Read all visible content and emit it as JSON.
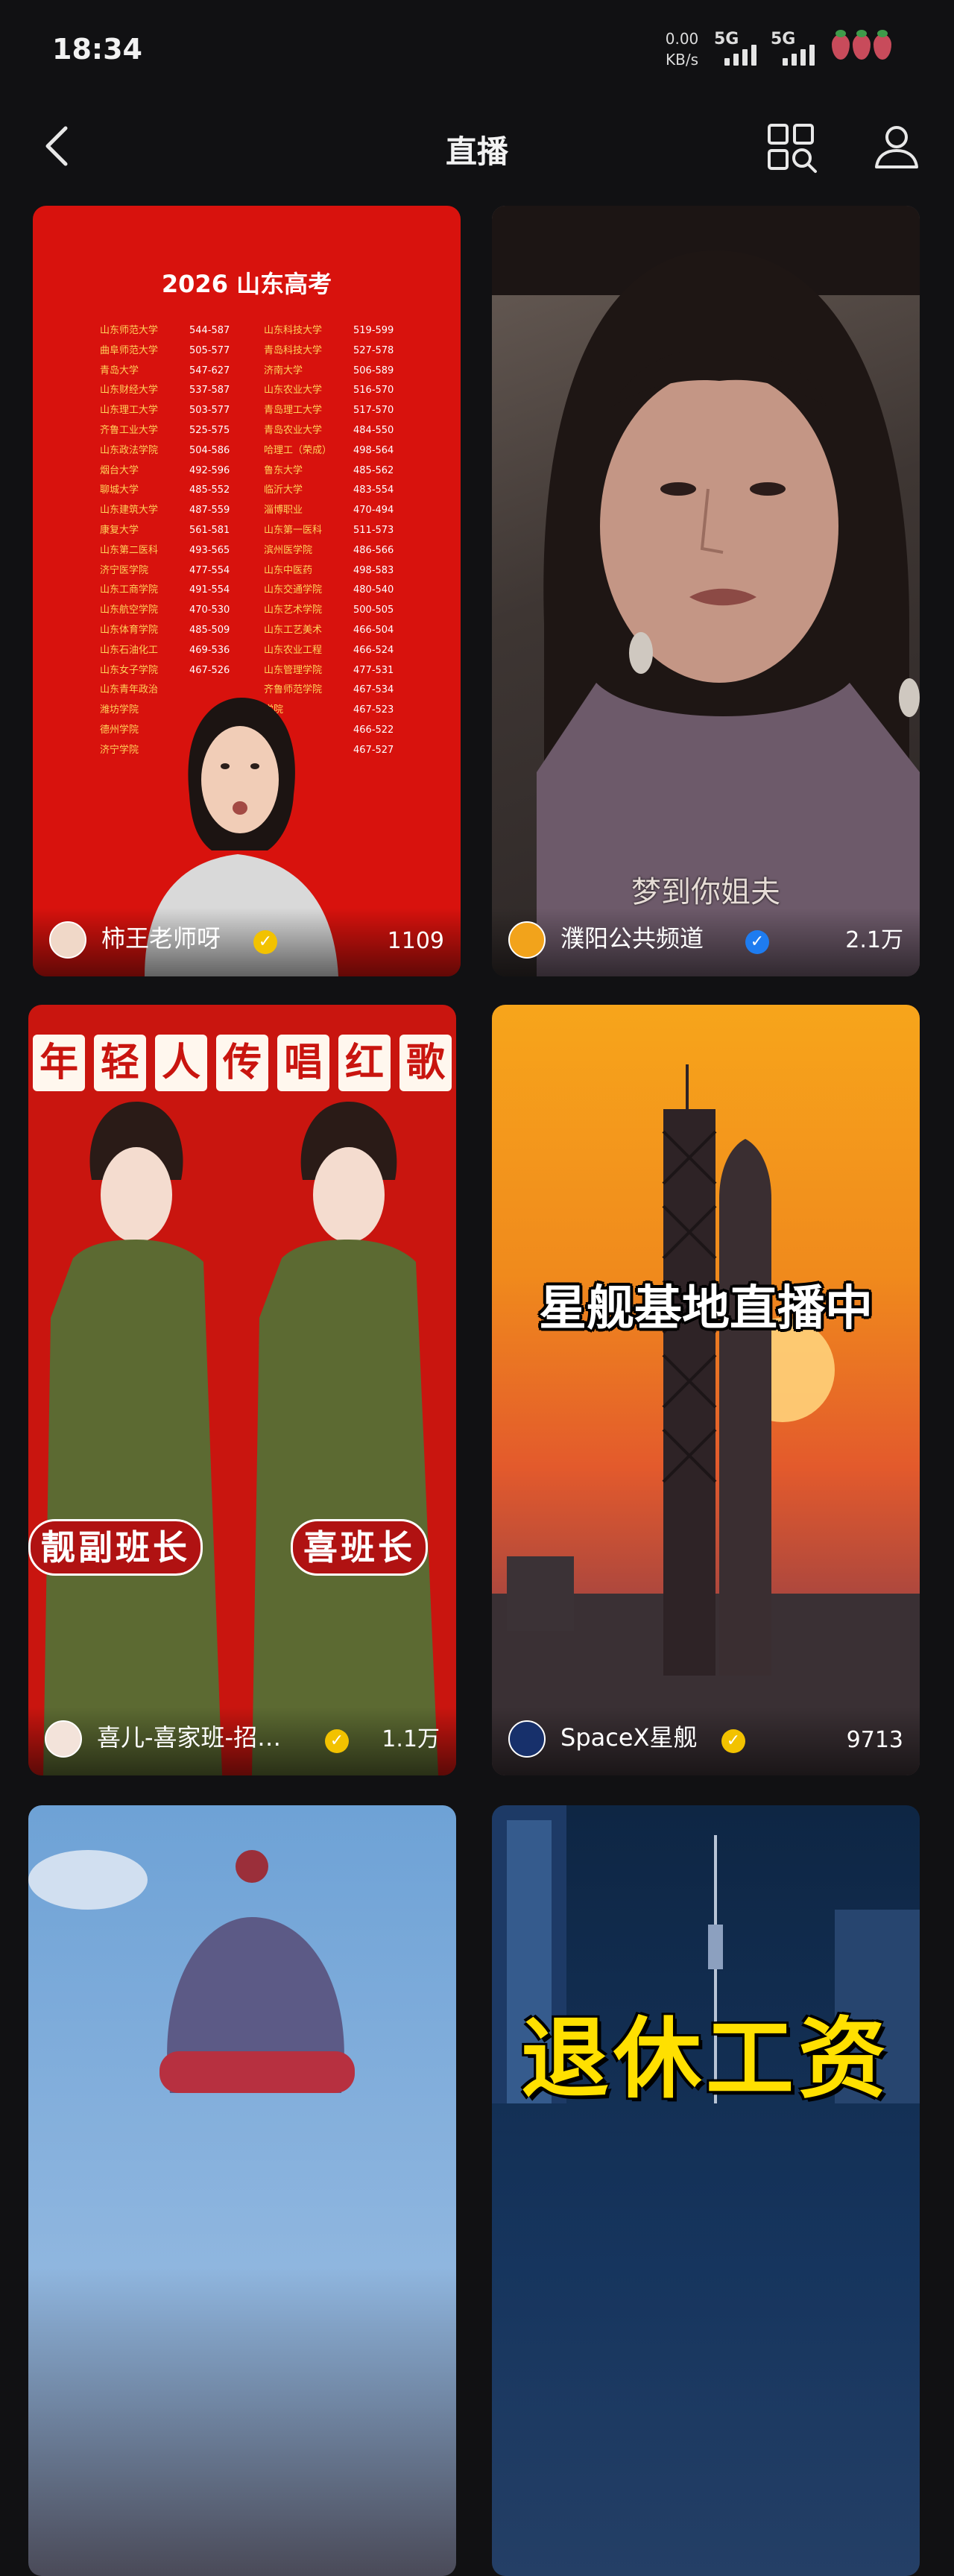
{
  "status_bar": {
    "time": "18:34",
    "speed_value": "0.00",
    "speed_unit": "KB/s",
    "net1": "5G",
    "net2": "5G"
  },
  "header": {
    "title": "直播"
  },
  "cards": [
    {
      "creator": "柿王老师呀",
      "count": "1109",
      "verified_color": "#f2c200",
      "poster_title": "2026 山东高考",
      "table": [
        [
          "山东师范大学",
          "544-587",
          "山东科技大学",
          "519-599"
        ],
        [
          "曲阜师范大学",
          "505-577",
          "青岛科技大学",
          "527-578"
        ],
        [
          "青岛大学",
          "547-627",
          "济南大学",
          "506-589"
        ],
        [
          "山东财经大学",
          "537-587",
          "山东农业大学",
          "516-570"
        ],
        [
          "山东理工大学",
          "503-577",
          "青岛理工大学",
          "517-570"
        ],
        [
          "齐鲁工业大学",
          "525-575",
          "青岛农业大学",
          "484-550"
        ],
        [
          "山东政法学院",
          "504-586",
          "哈理工（荣成）",
          "498-564"
        ],
        [
          "烟台大学",
          "492-596",
          "鲁东大学",
          "485-562"
        ],
        [
          "聊城大学",
          "485-552",
          "临沂大学",
          "483-554"
        ],
        [
          "山东建筑大学",
          "487-559",
          "淄博职业",
          "470-494"
        ],
        [
          "康复大学",
          "561-581",
          "山东第一医科",
          "511-573"
        ],
        [
          "山东第二医科",
          "493-565",
          "滨州医学院",
          "486-566"
        ],
        [
          "济宁医学院",
          "477-554",
          "山东中医药",
          "498-583"
        ],
        [
          "山东工商学院",
          "491-554",
          "山东交通学院",
          "480-540"
        ],
        [
          "山东航空学院",
          "470-530",
          "山东艺术学院",
          "500-505"
        ],
        [
          "山东体育学院",
          "485-509",
          "山东工艺美术",
          "466-504"
        ],
        [
          "山东石油化工",
          "469-536",
          "山东农业工程",
          "466-524"
        ],
        [
          "山东女子学院",
          "467-526",
          "山东管理学院",
          "477-531"
        ],
        [
          "山东青年政治",
          "",
          "齐鲁师范学院",
          "467-534"
        ],
        [
          "潍坊学院",
          "",
          "学院",
          "467-523"
        ],
        [
          "德州学院",
          "",
          "学院",
          "466-522"
        ],
        [
          "济宁学院",
          "",
          "学院",
          "467-527"
        ]
      ]
    },
    {
      "creator": "濮阳公共频道",
      "count": "2.1万",
      "verified_color": "#1e7cf0",
      "subtitle": "梦到你姐夫"
    },
    {
      "creator": "喜儿-喜家班-招…",
      "count": "1.1万",
      "verified_color": "#f2c200",
      "banner": [
        "年",
        "轻",
        "人",
        "传",
        "唱",
        "红",
        "歌"
      ],
      "tag_left": "靓副班长",
      "tag_right": "喜班长"
    },
    {
      "creator": "SpaceX星舰",
      "count": "9713",
      "verified_color": "#f2c200",
      "headline": "星舰基地直播中"
    },
    {},
    {
      "headline": "退休工资"
    }
  ]
}
